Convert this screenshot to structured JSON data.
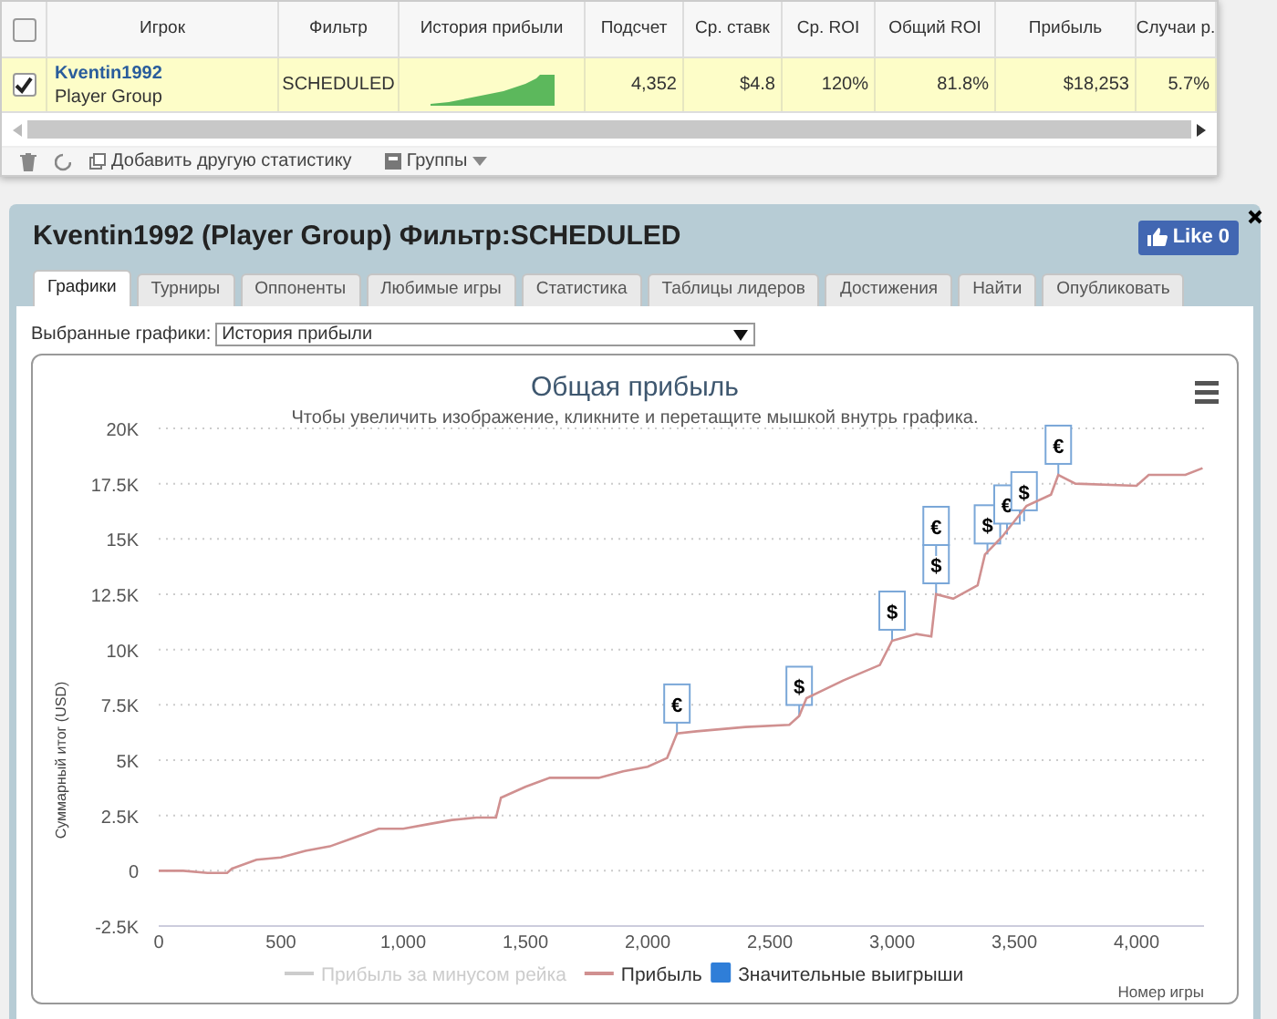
{
  "table": {
    "columns": [
      "Игрок",
      "Фильтр",
      "История прибыли",
      "Подсчет",
      "Ср. ставк",
      "Ср. ROI",
      "Общий ROI",
      "Прибыль",
      "Случаи р."
    ],
    "rows": [
      {
        "selected": true,
        "checked": true,
        "player": "Kventin1992",
        "group": "Player Group",
        "filter": "SCHEDULED",
        "count": "4,352",
        "avg_stake": "$4.8",
        "avg_roi": "120%",
        "total_roi": "81.8%",
        "profit": "$18,253",
        "cases": "5.7%"
      }
    ],
    "header_checked": false,
    "toolbar": {
      "add_stat": "Добавить другую статистику",
      "groups": "Группы"
    }
  },
  "panel": {
    "title": "Kventin1992 (Player Group) Фильтр:SCHEDULED",
    "like": "Like 0",
    "tabs": [
      {
        "label": "Графики",
        "selected": true
      },
      {
        "label": "Турниры",
        "selected": false
      },
      {
        "label": "Оппоненты",
        "selected": false
      },
      {
        "label": "Любимые игры",
        "selected": false
      },
      {
        "label": "Статистика",
        "selected": false
      },
      {
        "label": "Таблицы лидеров",
        "selected": false
      },
      {
        "label": "Достижения",
        "selected": false
      },
      {
        "label": "Найти",
        "selected": false
      },
      {
        "label": "Опубликовать",
        "selected": false
      }
    ],
    "chart_select": {
      "label": "Выбранные графики:",
      "value": "История прибыли"
    },
    "chart_subtitle": "Чтобы увеличить изображение, кликните и перетащите мышкой внутрь графика.",
    "legend": [
      {
        "label": "Прибыль за минусом рейка",
        "kind": "line",
        "enabled": false
      },
      {
        "kind": "series",
        "enabled": true
      },
      {
        "label": "Значительные выигрыши",
        "kind": "flag",
        "enabled": true
      }
    ],
    "chart_data": {
      "type": "line",
      "grid": true,
      "title": "Общая прибыль",
      "xlabel": "Номер игры",
      "ylabel": "Суммарный итог (USD)",
      "x": [
        0,
        100,
        200,
        280,
        300,
        400,
        500,
        600,
        700,
        800,
        900,
        1000,
        1100,
        1200,
        1300,
        1380,
        1400,
        1500,
        1600,
        1800,
        1900,
        2000,
        2080,
        2120,
        2200,
        2400,
        2580,
        2620,
        2650,
        2800,
        2950,
        3000,
        3100,
        3160,
        3180,
        3250,
        3350,
        3380,
        3450,
        3550,
        3650,
        3680,
        3750,
        4000,
        4050,
        4200,
        4270
      ],
      "series": [
        {
          "name": "Прибыль",
          "color": "#d09090",
          "values": [
            0,
            0,
            -100,
            -100,
            100,
            500,
            600,
            900,
            1100,
            1500,
            1900,
            1900,
            2100,
            2300,
            2400,
            2400,
            3300,
            3800,
            4200,
            4200,
            4500,
            4700,
            5100,
            6200,
            6300,
            6500,
            6600,
            7000,
            7800,
            8600,
            9300,
            10400,
            10700,
            10600,
            12500,
            12300,
            12900,
            14300,
            15100,
            16500,
            17000,
            17900,
            17500,
            17400,
            17900,
            17900,
            18200
          ]
        }
      ],
      "xlim": [
        0,
        4276
      ],
      "ylim": [
        -2500,
        20000
      ],
      "xticks": [
        {
          "value": 0,
          "label": "0"
        },
        {
          "value": 500,
          "label": "500"
        },
        {
          "value": 1000,
          "label": "1,000"
        },
        {
          "value": 1500,
          "label": "1,500"
        },
        {
          "value": 2000,
          "label": "2,000"
        },
        {
          "value": 2500,
          "label": "2,500"
        },
        {
          "value": 3000,
          "label": "3,000"
        },
        {
          "value": 3500,
          "label": "3,500"
        },
        {
          "value": 4000,
          "label": "4,000"
        }
      ],
      "yticks": [
        {
          "value": -2500,
          "label": "-2.5K"
        },
        {
          "value": 0,
          "label": "0"
        },
        {
          "value": 2500,
          "label": "2.5K"
        },
        {
          "value": 5000,
          "label": "5K"
        },
        {
          "value": 7500,
          "label": "7.5K"
        },
        {
          "value": 10000,
          "label": "10K"
        },
        {
          "value": 12500,
          "label": "12.5K"
        },
        {
          "value": 15000,
          "label": "15K"
        },
        {
          "value": 17500,
          "label": "17.5K"
        },
        {
          "value": 20000,
          "label": "20K"
        }
      ],
      "annotations": [
        {
          "x": 2120,
          "y": 6200,
          "text": "€"
        },
        {
          "x": 2620,
          "y": 7000,
          "text": "$"
        },
        {
          "x": 3000,
          "y": 10400,
          "text": "$"
        },
        {
          "x": 3180,
          "y": 12500,
          "text": "$"
        },
        {
          "x": 3180,
          "y": 12500,
          "text": "€"
        },
        {
          "x": 3390,
          "y": 14300,
          "text": "$"
        },
        {
          "x": 3470,
          "y": 15200,
          "text": "€"
        },
        {
          "x": 3540,
          "y": 15800,
          "text": "$"
        },
        {
          "x": 3680,
          "y": 17900,
          "text": "€"
        }
      ]
    }
  }
}
